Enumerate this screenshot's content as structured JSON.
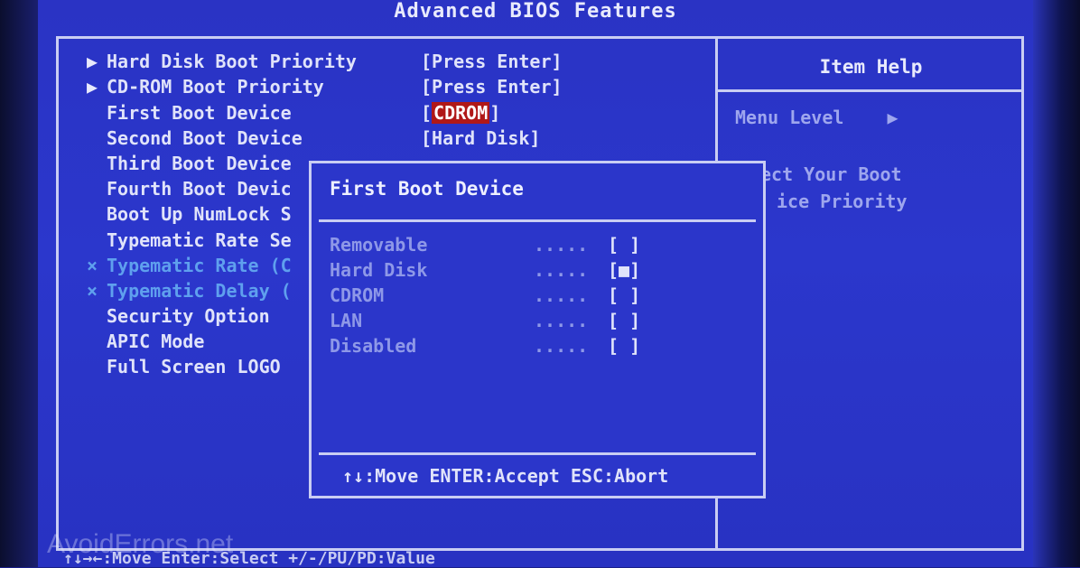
{
  "header": {
    "title": "Advanced BIOS Features"
  },
  "menu": [
    {
      "label": "Hard Disk Boot Priority",
      "value": "[Press Enter]",
      "submenu": true,
      "disabled": false
    },
    {
      "label": "CD-ROM Boot Priority",
      "value": "[Press Enter]",
      "submenu": true,
      "disabled": false
    },
    {
      "label": "First Boot Device",
      "value": "CDROM",
      "submenu": false,
      "disabled": false,
      "highlighted": true
    },
    {
      "label": "Second Boot Device",
      "value": "[Hard Disk]",
      "submenu": false,
      "disabled": false
    },
    {
      "label": "Third Boot Device",
      "value": "",
      "submenu": false,
      "disabled": false
    },
    {
      "label": "Fourth Boot Devic",
      "value": "",
      "submenu": false,
      "disabled": false
    },
    {
      "label": "Boot Up NumLock S",
      "value": "",
      "submenu": false,
      "disabled": false
    },
    {
      "label": "Typematic Rate Se",
      "value": "",
      "submenu": false,
      "disabled": false
    },
    {
      "label": "Typematic Rate (C",
      "value": "",
      "submenu": false,
      "disabled": true
    },
    {
      "label": "Typematic Delay (",
      "value": "",
      "submenu": false,
      "disabled": true
    },
    {
      "label": "Security Option",
      "value": "",
      "submenu": false,
      "disabled": false
    },
    {
      "label": "APIC Mode",
      "value": "",
      "submenu": false,
      "disabled": false
    },
    {
      "label": "Full Screen LOGO",
      "value": "",
      "submenu": false,
      "disabled": false
    }
  ],
  "item_help": {
    "title": "Item Help",
    "menu_level_label": "Menu Level",
    "menu_level_marker": "▶",
    "text_line1": "ect Your Boot",
    "text_line2": "ice Priority"
  },
  "popup": {
    "title": "First Boot Device",
    "options": [
      {
        "label": "Removable",
        "dots": ".....",
        "checkbox": "[ ]"
      },
      {
        "label": "Hard Disk",
        "dots": ".....",
        "checkbox": "[■]"
      },
      {
        "label": "CDROM",
        "dots": ".....",
        "checkbox": "[ ]"
      },
      {
        "label": "LAN",
        "dots": ".....",
        "checkbox": "[ ]"
      },
      {
        "label": "Disabled",
        "dots": ".....",
        "checkbox": "[ ]"
      }
    ],
    "footer": "↑↓:Move ENTER:Accept ESC:Abort"
  },
  "bottom_bar": {
    "text": "↑↓→←:Move  Enter:Select  +/-/PU/PD:Value"
  },
  "watermark": "AvoidErrors.net",
  "colors": {
    "background": "#2b37cc",
    "border": "#c9cdf3",
    "highlight": "#b01818",
    "disabled_text": "#5fa0ee"
  }
}
